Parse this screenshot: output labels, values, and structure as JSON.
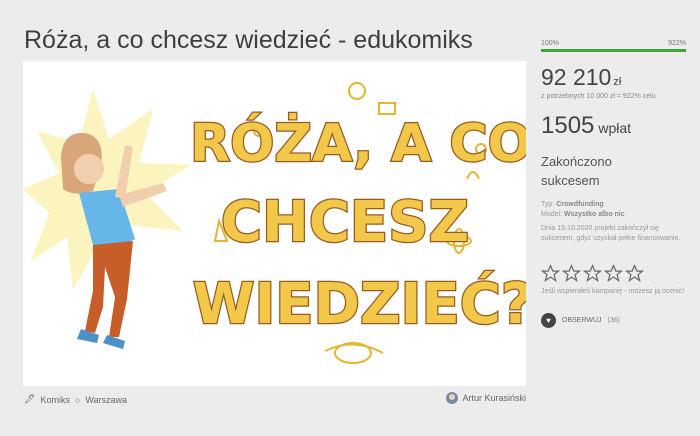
{
  "page": {
    "title": "Róża, a co chcesz wiedzieć - edukomiks"
  },
  "hero": {
    "lines": [
      "RÓŻA, A CO",
      "CHCESZ",
      "WIEDZIEĆ?"
    ]
  },
  "meta": {
    "category": "Komiks",
    "location": "Warszawa",
    "author": "Artur Kurasiński"
  },
  "funding": {
    "progress_start_label": "100%",
    "progress_end_label": "922%",
    "progress_fraction": 1.0,
    "amount": "92 210",
    "currency": "zł",
    "goal_text": "z potrzebnych 10 000 zł = 922% celu",
    "backers_count": "1505",
    "backers_label": "wpłat",
    "status": "Zakończono sukcesem",
    "type_label": "Typ:",
    "type_value": "Crowdfunding",
    "model_label": "Model:",
    "model_value": "Wszystko albo nic",
    "finished_text": "Dnia 15.10.2020 projekt zakończył się sukcesem, gdyż uzyskał pełne finansowanie.",
    "rating_note": "Jeśli wspierałeś kampanię - możesz ją ocenić!",
    "follow_label": "OBSERWUJ",
    "follow_count": "(36)"
  },
  "colors": {
    "accent": "#3aa63a",
    "lettering": "#f2c84b",
    "lettering_outline": "#9a5a1e"
  },
  "icons": {
    "category": "pin-icon",
    "location": "map-pin-icon",
    "follow": "heart-icon",
    "rating": "star-icon"
  }
}
